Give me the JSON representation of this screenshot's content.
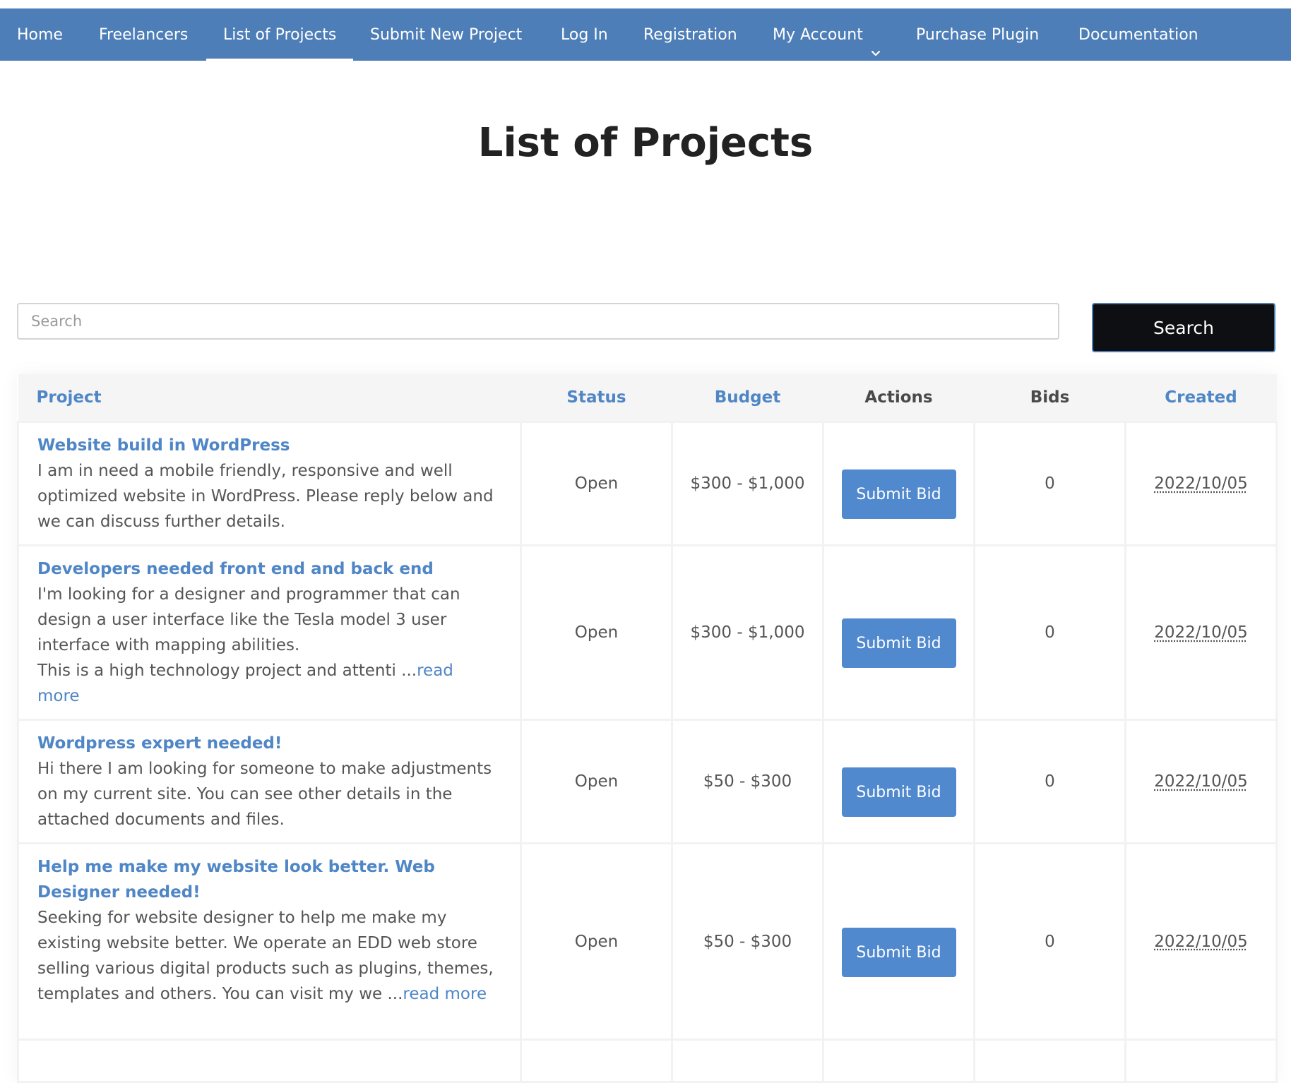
{
  "nav": {
    "items": [
      {
        "label": "Home"
      },
      {
        "label": "Freelancers"
      },
      {
        "label": "List of Projects",
        "active": true
      },
      {
        "label": "Submit New Project"
      },
      {
        "label": "Log In"
      },
      {
        "label": "Registration"
      },
      {
        "label": "My Account",
        "icon": "chevron-down-icon"
      },
      {
        "label": "Purchase Plugin"
      },
      {
        "label": "Documentation"
      }
    ]
  },
  "page": {
    "title": "List of Projects"
  },
  "search": {
    "placeholder": "Search",
    "value": "",
    "button_label": "Search"
  },
  "table": {
    "headers": {
      "project": "Project",
      "status": "Status",
      "budget": "Budget",
      "actions": "Actions",
      "bids": "Bids",
      "created": "Created"
    },
    "rows": [
      {
        "title": "Website build in WordPress",
        "description": "I am in need a mobile friendly, responsive and well optimized website in WordPress. Please reply below and we can discuss further details.",
        "read_more": "",
        "status": "Open",
        "budget": "$300 - $1,000",
        "action_label": "Submit Bid",
        "bids": "0",
        "created": "2022/10/05"
      },
      {
        "title": "Developers needed front end and back end",
        "description": "I'm looking for a designer and programmer that can design a user interface like the Tesla model 3 user interface with mapping abilities.\nThis is a high technology project and attenti ...",
        "read_more": "read more",
        "status": "Open",
        "budget": "$300 - $1,000",
        "action_label": "Submit Bid",
        "bids": "0",
        "created": "2022/10/05"
      },
      {
        "title": "Wordpress expert needed!",
        "description": "Hi there I am looking for someone to make adjustments on my current site. You can see other details in the attached documents and files.",
        "read_more": "",
        "status": "Open",
        "budget": "$50 - $300",
        "action_label": "Submit Bid",
        "bids": "0",
        "created": "2022/10/05"
      },
      {
        "title": "Help me make my website look better. Web Designer needed!",
        "description": "Seeking for website designer to help me make my existing website better. We operate an EDD web store selling various digital products such as plugins, themes, templates and others. You can visit my we ...",
        "read_more": "read more",
        "status": "Open",
        "budget": "$50 - $300",
        "action_label": "Submit Bid",
        "bids": "0",
        "created": "2022/10/05"
      }
    ]
  },
  "colors": {
    "nav_bg": "#4e7eb7",
    "link": "#4f86c6",
    "button": "#5189cf",
    "search_button_bg": "#0d0f12",
    "title": "#222222"
  }
}
